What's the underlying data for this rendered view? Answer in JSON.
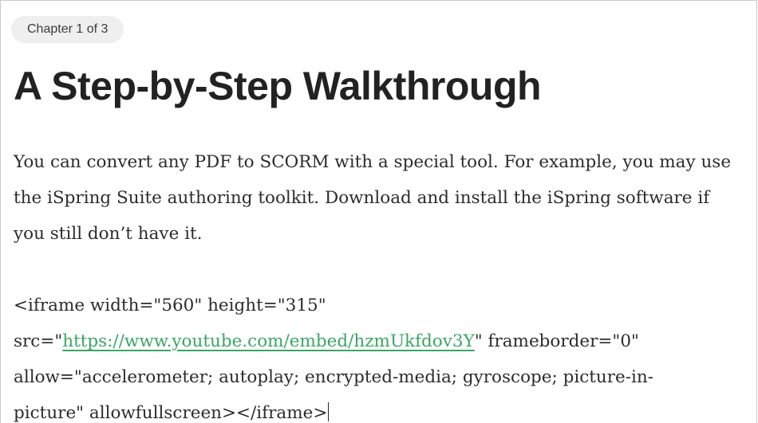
{
  "chapter_badge": "Chapter 1 of 3",
  "heading": "A Step-by-Step Walkthrough",
  "paragraph_lines": [
    "You can convert any PDF to SCORM with a special tool. For example, you may use",
    "the iSpring Suite authoring toolkit. Download and install the iSpring software if",
    "you still don’t have it."
  ],
  "embed": {
    "line1": "<iframe width=\"560\" height=\"315\"",
    "line2_prefix": "src=\"",
    "link_url": "https://www.youtube.com/embed/hzmUkfdov3Y",
    "line2_suffix": "\" frameborder=\"0\"",
    "line3": "allow=\"accelerometer; autoplay; encrypted-media; gyroscope; picture-in-",
    "line4": "picture\" allowfullscreen></iframe>"
  },
  "colors": {
    "link": "#3aa664",
    "text": "#2c2c2c",
    "badge_bg": "#efefef"
  }
}
